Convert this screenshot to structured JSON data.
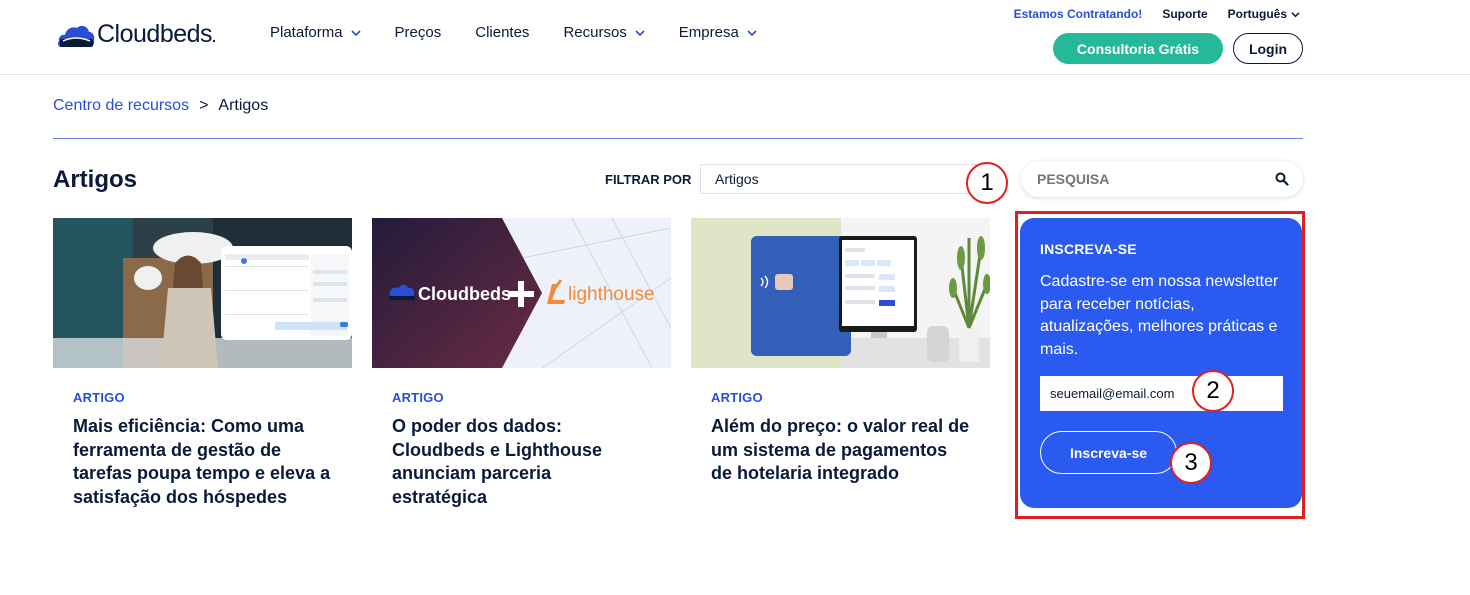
{
  "header": {
    "logo_text": "Cloudbeds",
    "logo_suffix": ".",
    "nav": [
      {
        "label": "Plataforma",
        "has_dropdown": true
      },
      {
        "label": "Preços",
        "has_dropdown": false
      },
      {
        "label": "Clientes",
        "has_dropdown": false
      },
      {
        "label": "Recursos",
        "has_dropdown": true
      },
      {
        "label": "Empresa",
        "has_dropdown": true
      }
    ],
    "hiring": "Estamos Contratando!",
    "support": "Suporte",
    "language": "Português",
    "consult_button": "Consultoria Grátis",
    "login_button": "Login"
  },
  "breadcrumb": {
    "parent": "Centro de recursos",
    "separator": ">",
    "current": "Artigos"
  },
  "page": {
    "title": "Artigos",
    "filter_label": "FILTRAR POR",
    "filter_value": "Artigos",
    "search_placeholder": "PESQUISA"
  },
  "annotations": [
    "1",
    "2",
    "3"
  ],
  "cards": [
    {
      "category": "ARTIGO",
      "title": "Mais eficiência: Como uma ferramenta de gestão de tarefas poupa tempo e eleva a satisfação dos hóspedes"
    },
    {
      "category": "ARTIGO",
      "title": "O poder dos dados: Cloudbeds e Lighthouse anunciam parceria estratégica",
      "image_text_left": "Cloudbeds",
      "image_text_right": "lighthouse"
    },
    {
      "category": "ARTIGO",
      "title": "Além do preço: o valor real de um sistema de pagamentos de hotelaria integrado"
    }
  ],
  "newsletter": {
    "title": "INSCREVA-SE",
    "description": "Cadastre-se em nossa newsletter para receber notícias, atualizações, melhores práticas e mais.",
    "email_value": "seuemail@email.com",
    "button": "Inscreva-se"
  },
  "colors": {
    "brand_blue": "#2a4fd6",
    "newsletter_blue": "#2b5af0",
    "consult_green": "#25b99a",
    "annotation_red": "#e02020",
    "text_dark": "#0a1a3a"
  }
}
